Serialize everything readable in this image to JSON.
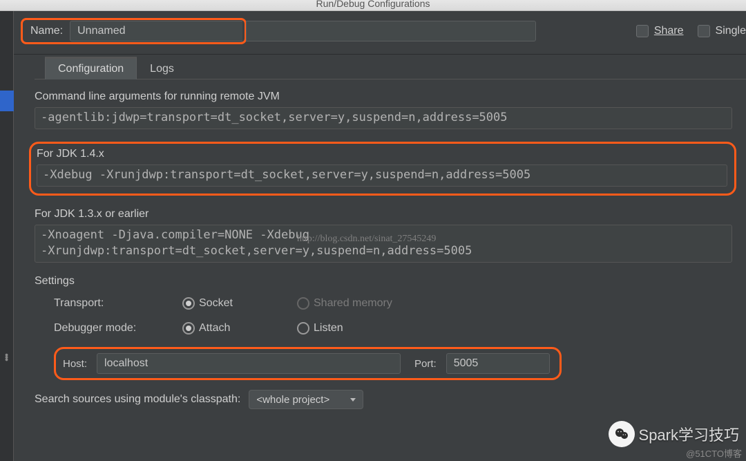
{
  "window": {
    "title": "Run/Debug Configurations"
  },
  "nameRow": {
    "label": "Name:",
    "value": "Unnamed"
  },
  "topChecks": {
    "share": "Share",
    "single": "Single"
  },
  "tabs": {
    "config": "Configuration",
    "logs": "Logs"
  },
  "sections": {
    "cmdline": {
      "label": "Command line arguments for running remote JVM",
      "value": "-agentlib:jdwp=transport=dt_socket,server=y,suspend=n,address=5005"
    },
    "jdk14": {
      "label": "For JDK 1.4.x",
      "value": "-Xdebug -Xrunjdwp:transport=dt_socket,server=y,suspend=n,address=5005"
    },
    "jdk13": {
      "label": "For JDK 1.3.x or earlier",
      "value": "-Xnoagent -Djava.compiler=NONE -Xdebug\n-Xrunjdwp:transport=dt_socket,server=y,suspend=n,address=5005"
    }
  },
  "settings": {
    "title": "Settings",
    "transport": {
      "label": "Transport:",
      "opt1": "Socket",
      "opt2": "Shared memory"
    },
    "mode": {
      "label": "Debugger mode:",
      "opt1": "Attach",
      "opt2": "Listen"
    },
    "host": {
      "label": "Host:",
      "value": "localhost"
    },
    "port": {
      "label": "Port:",
      "value": "5005"
    },
    "search": {
      "label": "Search sources using module's classpath:",
      "value": "<whole project>"
    }
  },
  "watermark": "http://blog.csdn.net/sinat_27545249",
  "badge": "Spark学习技巧",
  "credit": "@51CTO博客"
}
